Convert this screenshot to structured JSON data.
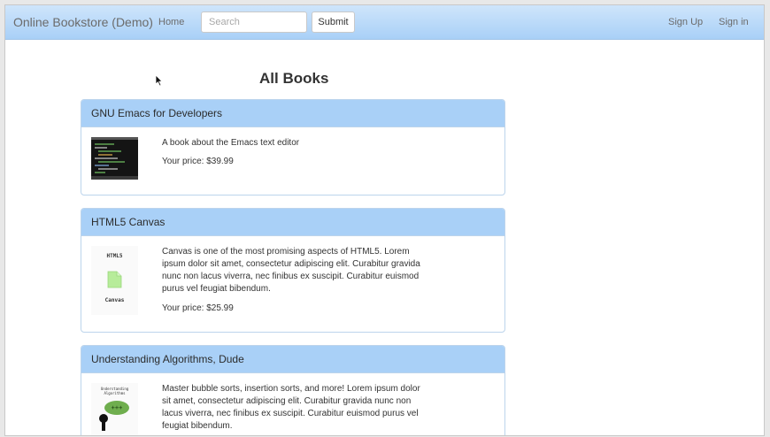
{
  "navbar": {
    "brand": "Online Bookstore (Demo)",
    "home": "Home",
    "search_placeholder": "Search",
    "submit": "Submit",
    "sign_up": "Sign Up",
    "sign_in": "Sign in"
  },
  "page": {
    "title": "All Books"
  },
  "books": [
    {
      "title": "GNU Emacs for Developers",
      "description": "A book about the Emacs text editor",
      "price": "Your price: $39.99"
    },
    {
      "title": "HTML5 Canvas",
      "description": "Canvas is one of the most promising aspects of HTML5. Lorem ipsum dolor sit amet, consectetur adipiscing elit. Curabitur gravida nunc non lacus viverra, nec finibus ex suscipit. Curabitur euismod purus vel feugiat bibendum.",
      "price": "Your price: $25.99",
      "cover_top": "HTML5",
      "cover_bottom": "Canvas"
    },
    {
      "title": "Understanding Algorithms, Dude",
      "description": "Master bubble sorts, insertion sorts, and more! Lorem ipsum dolor sit amet, consectetur adipiscing elit. Curabitur gravida nunc non lacus viverra, nec finibus ex suscipit. Curabitur euismod purus vel feugiat bibendum.",
      "cover_top": "Understanding Algorithms",
      "cover_badge": "+++"
    }
  ],
  "colors": {
    "navbar": "#a9d0f7",
    "panel_heading": "#a9d0f7"
  },
  "icons": [
    "mouse-cursor-icon",
    "file-icon"
  ]
}
